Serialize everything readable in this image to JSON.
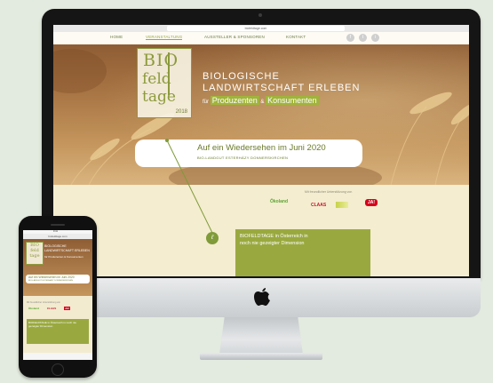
{
  "browser": {
    "url": "biofeldtage.com"
  },
  "nav": {
    "items": [
      "HOME",
      "VERANSTALTUNG",
      "AUSSTELLER & SPONSOREN",
      "KONTAKT"
    ],
    "active_index": 1,
    "social": [
      "f",
      "t",
      "i"
    ]
  },
  "logo": {
    "bio": "BIO",
    "feld": "feld",
    "tage": "tage",
    "year": "2018"
  },
  "hero": {
    "title_line1": "BIOLOGISCHE",
    "title_line2": "LANDWIRTSCHAFT ERLEBEN",
    "sub_prefix": "für",
    "sub_highlight1": "Produzenten",
    "sub_connector": "&",
    "sub_highlight2": "Konsumenten"
  },
  "reunion": {
    "title": "Auf ein Wiedersehen im Juni 2020",
    "subtitle": "BIO-LANDGUT ESTERHÁZY DONNERSKIRCHEN"
  },
  "partners": {
    "caption": "Mit freundlicher Unterstützung von",
    "logos": [
      "Ökoland",
      "CLAAS",
      "JA!"
    ],
    "brand_colors": [
      "#5aa532",
      "#c8102e",
      "#d6001c"
    ]
  },
  "banner": {
    "line1": "BIOFELDTAGE in Österreich in",
    "line2": "noch nie gezeigter Dimension"
  },
  "phone": {
    "url": "biofeldtage.com",
    "status_time": "9:41",
    "hero_title": "BIOLOGISCHE LANDWIRTSCHAFT ERLEBEN",
    "hero_sub": "für Produzenten & Konsumenten",
    "reunion_title": "Auf ein Wiedersehen im Juni 2020",
    "reunion_sub": "BIO-LANDGUT ESTERHÁZY DONNERSKIRCHEN",
    "partner_caption": "Mit freundlicher Unterstützung von",
    "banner_text": "BIOFELDTAGE in Österreich in noch nie gezeigter Dimension",
    "logo_text": "BIO feld tage"
  },
  "colors": {
    "accent_green": "#9aa93f",
    "logo_green": "#8c9a3c",
    "text_green": "#6b7a2a",
    "page_bg": "#e3eadf"
  }
}
